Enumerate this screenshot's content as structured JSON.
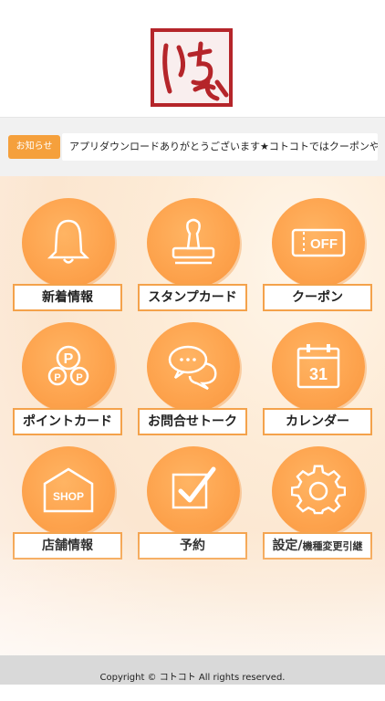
{
  "header": {
    "logo_alt": "いちみ"
  },
  "news": {
    "badge": "お知らせ",
    "text": "アプリダウンロードありがとうございます★コトコトではクーポンやスタ"
  },
  "menu": [
    {
      "label": "新着情報",
      "icon": "bell-icon"
    },
    {
      "label": "スタンプカード",
      "icon": "stamp-icon"
    },
    {
      "label": "クーポン",
      "icon": "coupon-icon",
      "icon_text": "OFF"
    },
    {
      "label": "ポイントカード",
      "icon": "points-icon",
      "icon_text": "P"
    },
    {
      "label": "お問合せトーク",
      "icon": "chat-icon"
    },
    {
      "label": "カレンダー",
      "icon": "calendar-icon",
      "icon_text": "31"
    },
    {
      "label": "店舗情報",
      "icon": "shop-icon",
      "icon_text": "SHOP"
    },
    {
      "label": "予約",
      "icon": "checkbox-icon"
    },
    {
      "label": "設定/",
      "label_small": "機種変更引継",
      "icon": "gear-icon"
    }
  ],
  "footer": {
    "copyright": "Copyright © コトコト All rights reserved."
  },
  "colors": {
    "accent": "#f5a03c",
    "circle": "#fda24c",
    "logo": "#b5252a"
  }
}
